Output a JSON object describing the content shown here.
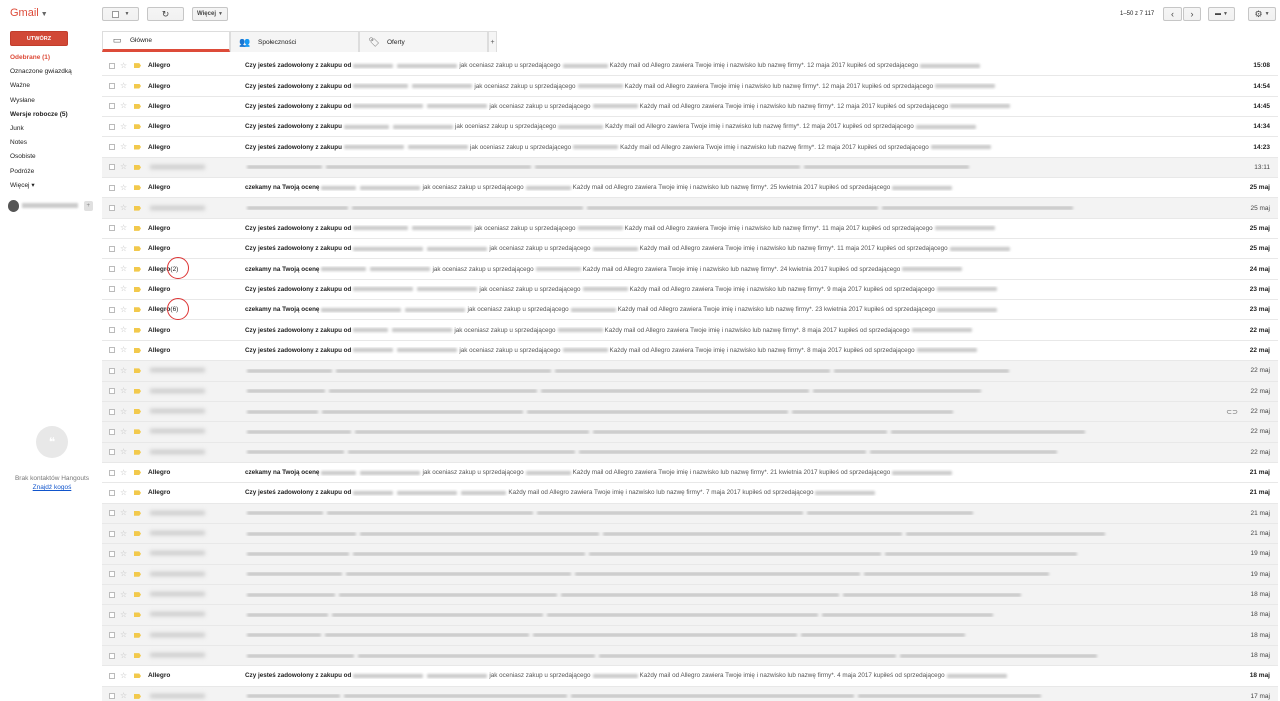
{
  "header": {
    "app_name": "Gmail",
    "more_label": "Więcej",
    "pagination": "1–50 z 7 117"
  },
  "compose_label": "UTWÓRZ",
  "nav": [
    {
      "label": "Odebrane (1)",
      "style": "active"
    },
    {
      "label": "Oznaczone gwiazdką",
      "style": ""
    },
    {
      "label": "Ważne",
      "style": ""
    },
    {
      "label": "Wysłane",
      "style": ""
    },
    {
      "label": "Wersje robocze (5)",
      "style": "bold"
    },
    {
      "label": "Junk",
      "style": ""
    },
    {
      "label": "Notes",
      "style": ""
    },
    {
      "label": "Osobiste",
      "style": ""
    },
    {
      "label": "Podróże",
      "style": ""
    },
    {
      "label": "Więcej",
      "style": ""
    }
  ],
  "hangouts": {
    "no_contacts": "Brak kontaktów Hangouts",
    "find_someone": "Znajdź kogoś"
  },
  "tabs": [
    {
      "label": "Główne",
      "icon": "inbox-icon"
    },
    {
      "label": "Społeczności",
      "icon": "people-icon"
    },
    {
      "label": "Oferty",
      "icon": "tag-icon"
    }
  ],
  "emails": [
    {
      "sender": "Allegro",
      "count": "",
      "subject": "Czy jesteś zadowolony z zakupu od",
      "snippet": "jak oceniasz zakup u sprzedającego",
      "tail": "Każdy mail od Allegro zawiera Twoje imię i nazwisko lub nazwę firmy*. 12 maja 2017 kupiłeś od sprzedającego",
      "date": "15:08",
      "unread": true
    },
    {
      "sender": "Allegro",
      "count": "",
      "subject": "Czy jesteś zadowolony z zakupu od",
      "snippet": "jak oceniasz zakup u sprzedającego",
      "tail": "Każdy mail od Allegro zawiera Twoje imię i nazwisko lub nazwę firmy*. 12 maja 2017 kupiłeś od sprzedającego",
      "date": "14:54",
      "unread": true
    },
    {
      "sender": "Allegro",
      "count": "",
      "subject": "Czy jesteś zadowolony z zakupu od",
      "snippet": "jak oceniasz zakup u sprzedającego",
      "tail": "Każdy mail od Allegro zawiera Twoje imię i nazwisko lub nazwę firmy*. 12 maja 2017 kupiłeś od sprzedającego",
      "date": "14:45",
      "unread": true
    },
    {
      "sender": "Allegro",
      "count": "",
      "subject": "Czy jesteś zadowolony z zakupu",
      "snippet": "jak oceniasz zakup u sprzedającego",
      "tail": "Każdy mail od Allegro zawiera Twoje imię i nazwisko lub nazwę firmy*. 12 maja 2017 kupiłeś od sprzedającego",
      "date": "14:34",
      "unread": true
    },
    {
      "sender": "Allegro",
      "count": "",
      "subject": "Czy jesteś zadowolony z zakupu",
      "snippet": "jak oceniasz zakup u sprzedającego",
      "tail": "Każdy mail od Allegro zawiera Twoje imię i nazwisko lub nazwę firmy*. 12 maja 2017 kupiłeś od sprzedającego",
      "date": "14:23",
      "unread": true
    },
    {
      "sender": "",
      "count": "",
      "subject": "",
      "snippet": "",
      "tail": "",
      "date": "13:11",
      "unread": false
    },
    {
      "sender": "Allegro",
      "count": "",
      "subject": "czekamy na Twoją ocenę",
      "snippet": "jak oceniasz zakup u sprzedającego",
      "tail": "Każdy mail od Allegro zawiera Twoje imię i nazwisko lub nazwę firmy*. 25 kwietnia 2017 kupiłeś od sprzedającego",
      "date": "25 maj",
      "unread": true
    },
    {
      "sender": "",
      "count": "",
      "subject": "",
      "snippet": "",
      "tail": "",
      "date": "25 maj",
      "unread": false
    },
    {
      "sender": "Allegro",
      "count": "",
      "subject": "Czy jesteś zadowolony z zakupu od",
      "snippet": "jak oceniasz zakup u sprzedającego",
      "tail": "Każdy mail od Allegro zawiera Twoje imię i nazwisko lub nazwę firmy*. 11 maja 2017 kupiłeś od sprzedającego",
      "date": "25 maj",
      "unread": true
    },
    {
      "sender": "Allegro",
      "count": "",
      "subject": "Czy jesteś zadowolony z zakupu od",
      "snippet": "jak oceniasz zakup u sprzedającego",
      "tail": "Każdy mail od Allegro zawiera Twoje imię i nazwisko lub nazwę firmy*. 11 maja 2017 kupiłeś od sprzedającego",
      "date": "25 maj",
      "unread": true
    },
    {
      "sender": "Allegro",
      "count": "(2)",
      "subject": "czekamy na Twoją ocenę",
      "snippet": "jak oceniasz zakup u sprzedającego",
      "tail": "Każdy mail od Allegro zawiera Twoje imię i nazwisko lub nazwę firmy*. 24 kwietnia 2017 kupiłeś od sprzedającego",
      "date": "24 maj",
      "unread": true
    },
    {
      "sender": "Allegro",
      "count": "",
      "subject": "Czy jesteś zadowolony z zakupu od",
      "snippet": "jak oceniasz zakup u sprzedającego",
      "tail": "Każdy mail od Allegro zawiera Twoje imię i nazwisko lub nazwę firmy*. 9 maja 2017 kupiłeś od sprzedającego",
      "date": "23 maj",
      "unread": true
    },
    {
      "sender": "Allegro",
      "count": "(6)",
      "subject": "czekamy na Twoją ocenę",
      "snippet": "jak oceniasz zakup u sprzedającego",
      "tail": "Każdy mail od Allegro zawiera Twoje imię i nazwisko lub nazwę firmy*. 23 kwietnia 2017 kupiłeś od sprzedającego",
      "date": "23 maj",
      "unread": true
    },
    {
      "sender": "Allegro",
      "count": "",
      "subject": "Czy jesteś zadowolony z zakupu od",
      "snippet": "jak oceniasz zakup u sprzedającego",
      "tail": "Każdy mail od Allegro zawiera Twoje imię i nazwisko lub nazwę firmy*. 8 maja 2017 kupiłeś od sprzedającego",
      "date": "22 maj",
      "unread": true
    },
    {
      "sender": "Allegro",
      "count": "",
      "subject": "Czy jesteś zadowolony z zakupu od",
      "snippet": "jak oceniasz zakup u sprzedającego",
      "tail": "Każdy mail od Allegro zawiera Twoje imię i nazwisko lub nazwę firmy*. 8 maja 2017 kupiłeś od sprzedającego",
      "date": "22 maj",
      "unread": true
    },
    {
      "sender": "",
      "count": "",
      "subject": "",
      "snippet": "",
      "tail": "",
      "date": "22 maj",
      "unread": false
    },
    {
      "sender": "",
      "count": "",
      "subject": "",
      "snippet": "",
      "tail": "",
      "date": "22 maj",
      "unread": false
    },
    {
      "sender": "",
      "count": "",
      "subject": "",
      "snippet": "",
      "tail": "",
      "date": "22 maj",
      "unread": false,
      "attach": true
    },
    {
      "sender": "",
      "count": "",
      "subject": "",
      "snippet": "",
      "tail": "",
      "date": "22 maj",
      "unread": false
    },
    {
      "sender": "",
      "count": "",
      "subject": "",
      "snippet": "",
      "tail": "",
      "date": "22 maj",
      "unread": false
    },
    {
      "sender": "Allegro",
      "count": "",
      "subject": "czekamy na Twoją ocenę",
      "snippet": "jak oceniasz zakup u sprzedającego",
      "tail": "Każdy mail od Allegro zawiera Twoje imię i nazwisko lub nazwę firmy*. 21 kwietnia 2017 kupiłeś od sprzedającego",
      "date": "21 maj",
      "unread": true
    },
    {
      "sender": "Allegro",
      "count": "",
      "subject": "Czy jesteś zadowolony z zakupu od",
      "snippet": "",
      "tail": "Każdy mail od Allegro zawiera Twoje imię i nazwisko lub nazwę firmy*. 7 maja 2017 kupiłeś od sprzedającego",
      "date": "21 maj",
      "unread": true
    },
    {
      "sender": "",
      "count": "",
      "subject": "",
      "snippet": "",
      "tail": "",
      "date": "21 maj",
      "unread": false
    },
    {
      "sender": "",
      "count": "",
      "subject": "",
      "snippet": "",
      "tail": "",
      "date": "21 maj",
      "unread": false
    },
    {
      "sender": "",
      "count": "",
      "subject": "",
      "snippet": "",
      "tail": "",
      "date": "19 maj",
      "unread": false
    },
    {
      "sender": "",
      "count": "",
      "subject": "",
      "snippet": "",
      "tail": "",
      "date": "19 maj",
      "unread": false
    },
    {
      "sender": "",
      "count": "",
      "subject": "",
      "snippet": "",
      "tail": "",
      "date": "18 maj",
      "unread": false
    },
    {
      "sender": "",
      "count": "",
      "subject": "",
      "snippet": "",
      "tail": "",
      "date": "18 maj",
      "unread": false
    },
    {
      "sender": "",
      "count": "",
      "subject": "",
      "snippet": "",
      "tail": "",
      "date": "18 maj",
      "unread": false
    },
    {
      "sender": "",
      "count": "",
      "subject": "",
      "snippet": "",
      "tail": "",
      "date": "18 maj",
      "unread": false
    },
    {
      "sender": "Allegro",
      "count": "",
      "subject": "Czy jesteś zadowolony z zakupu od",
      "snippet": "jak oceniasz zakup u sprzedającego",
      "tail": "Każdy mail od Allegro zawiera Twoje imię i nazwisko lub nazwę firmy*. 4 maja 2017 kupiłeś od sprzedającego",
      "date": "18 maj",
      "unread": true
    },
    {
      "sender": "",
      "count": "",
      "subject": "",
      "snippet": "",
      "tail": "",
      "date": "17 maj",
      "unread": false
    }
  ]
}
